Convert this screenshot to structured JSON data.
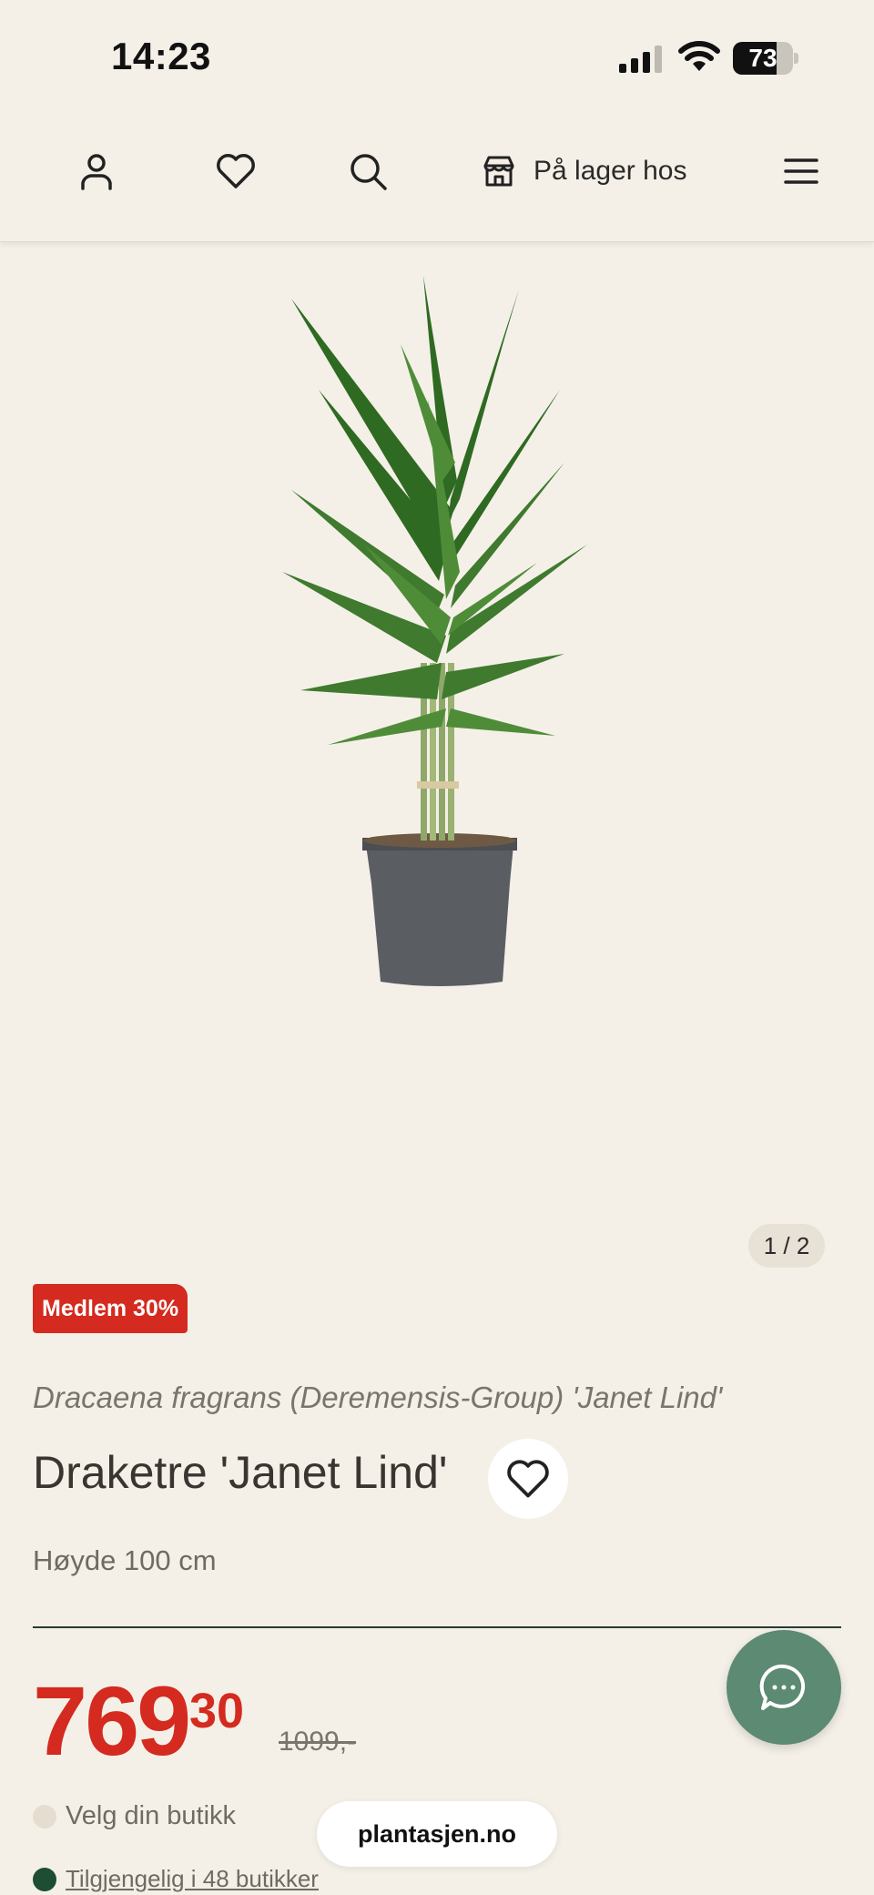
{
  "status_bar": {
    "time": "14:23",
    "battery_level": "73",
    "battery_fraction": 0.73
  },
  "header": {
    "account_icon": "user-icon",
    "favorites_icon": "heart-icon",
    "search_icon": "search-icon",
    "store_icon": "store-icon",
    "store_label": "På lager hos",
    "menu_icon": "hamburger-menu-icon"
  },
  "gallery": {
    "counter": "1 / 2"
  },
  "product": {
    "badge": "Medlem 30%",
    "latin_name": "Dracaena fragrans (Deremensis-Group) 'Janet Lind'",
    "title": "Draketre 'Janet Lind'",
    "height": "Høyde 100 cm",
    "price_main": "769",
    "price_cents": "30",
    "old_price": "1099,-"
  },
  "store": {
    "select_label": "Velg din butikk",
    "availability_label": "Tilgjengelig i 48 butikker"
  },
  "browser": {
    "domain": "plantasjen.no"
  },
  "colors": {
    "background": "#f4f0e8",
    "accent_red": "#d42a1f",
    "chat_green": "#5c8a72",
    "available_green": "#1d4d33"
  }
}
